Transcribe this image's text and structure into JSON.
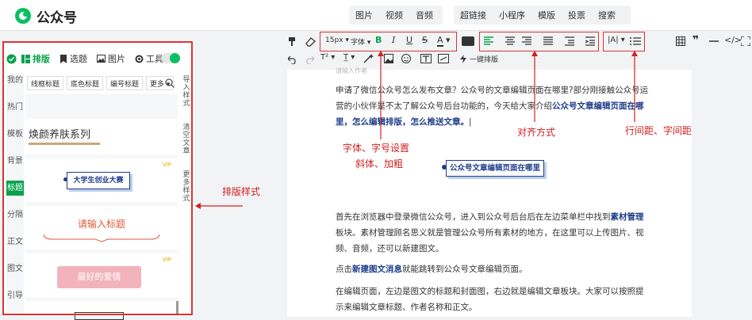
{
  "app": {
    "logo_text": "公众号",
    "brand_color": "#07c160"
  },
  "topnav": {
    "media": [
      "图片",
      "视频",
      "音频"
    ],
    "insert": [
      "超链接",
      "小程序",
      "模版",
      "投票",
      "搜索"
    ]
  },
  "left_panel": {
    "tabs": [
      "排版",
      "选题",
      "图片",
      "工具"
    ],
    "categories": [
      "我的",
      "热门",
      "模板",
      "背景",
      "标题",
      "分隔",
      "正文",
      "图文",
      "引导"
    ],
    "active_category": "标题",
    "subtabs": [
      "线框标题",
      "底色标题",
      "编号标题",
      "更多"
    ],
    "section_title": "焕颜养肤系列",
    "card1_text": "大学生创业大赛",
    "card2_text": "请输入标题",
    "card3_text": "最好的爱情",
    "vip": "VIP",
    "right_tools": [
      "导入样式",
      "清空文章",
      "更多样式"
    ]
  },
  "toolbar": {
    "font_size": "15px",
    "font_family": "字体",
    "one_key": "一键排版"
  },
  "editor": {
    "top_label": "请输入作者",
    "para1_a": "申请了微信公众号怎么发布文章？公众号的文章编辑页面在哪里?部分刚接触公众号运营的小伙伴是不太了解公众号后台功能的，今天给大家介绍",
    "para1_b": "公众号文章编辑页面在哪里，怎么编辑排版，怎么推送文章。",
    "heading_box": "公众号文章编辑页面在哪里",
    "para2_a": "首先在浏览器中登录微信公众号，进入到公众号后台后在左边菜单栏中找到",
    "para2_b": "素材管理",
    "para2_c": "板块。素材管理顾名思义就是管理公众号所有素材的地方，在这里可以上传图片、视频、音频，还可以新建图文。",
    "para3_a": "点击",
    "para3_b": "新建图文消息",
    "para3_c": "就能跳转到公众号文章编辑页面。",
    "para4": "在编辑页面，左边是图文的标题和封面图，右边就是编辑文章板块。大家可以按照提示来编辑文章标题、作者名称和正文。"
  },
  "annotations": {
    "font": "字体、字号设置",
    "italic": "斜体、加粗",
    "align": "对齐方式",
    "spacing": "行间距、字间距",
    "layout": "排版样式",
    "color": "#d21f1f"
  }
}
